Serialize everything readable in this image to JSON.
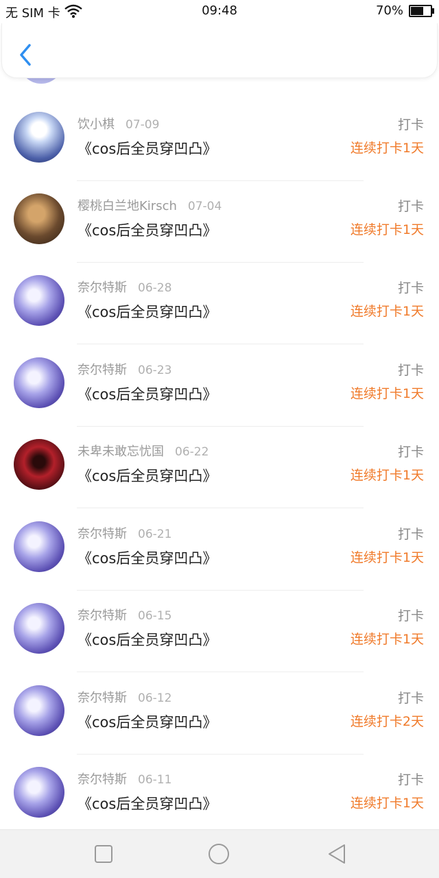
{
  "status_bar": {
    "carrier": "无 SIM 卡",
    "time": "09:48",
    "battery": "70%",
    "battery_level": 0.7
  },
  "header": {
    "back_icon": "chevron-left-icon"
  },
  "rows": [
    {
      "name": "饮小棋",
      "date": "07-09",
      "title": "《cos后全员穿凹凸》",
      "action": "打卡",
      "streak": "连续打卡1天",
      "avatar": "av-snow"
    },
    {
      "name": "樱桃白兰地Kirsch",
      "date": "07-04",
      "title": "《cos后全员穿凹凸》",
      "action": "打卡",
      "streak": "连续打卡1天",
      "avatar": "av-dark"
    },
    {
      "name": "奈尔特斯",
      "date": "06-28",
      "title": "《cos后全员穿凹凸》",
      "action": "打卡",
      "streak": "连续打卡1天",
      "avatar": "av-purple"
    },
    {
      "name": "奈尔特斯",
      "date": "06-23",
      "title": "《cos后全员穿凹凸》",
      "action": "打卡",
      "streak": "连续打卡1天",
      "avatar": "av-purple"
    },
    {
      "name": "未卑未敢忘忧国",
      "date": "06-22",
      "title": "《cos后全员穿凹凸》",
      "action": "打卡",
      "streak": "连续打卡1天",
      "avatar": "av-red"
    },
    {
      "name": "奈尔特斯",
      "date": "06-21",
      "title": "《cos后全员穿凹凸》",
      "action": "打卡",
      "streak": "连续打卡1天",
      "avatar": "av-purple"
    },
    {
      "name": "奈尔特斯",
      "date": "06-15",
      "title": "《cos后全员穿凹凸》",
      "action": "打卡",
      "streak": "连续打卡1天",
      "avatar": "av-purple"
    },
    {
      "name": "奈尔特斯",
      "date": "06-12",
      "title": "《cos后全员穿凹凸》",
      "action": "打卡",
      "streak": "连续打卡2天",
      "avatar": "av-purple"
    },
    {
      "name": "奈尔特斯",
      "date": "06-11",
      "title": "《cos后全员穿凹凸》",
      "action": "打卡",
      "streak": "连续打卡1天",
      "avatar": "av-purple"
    }
  ],
  "nav_bar": {
    "recent_icon": "square-icon",
    "home_icon": "circle-icon",
    "back_icon": "triangle-back-icon"
  },
  "colors": {
    "accent_blue": "#2f8ff0",
    "streak_orange": "#f07a2a"
  }
}
